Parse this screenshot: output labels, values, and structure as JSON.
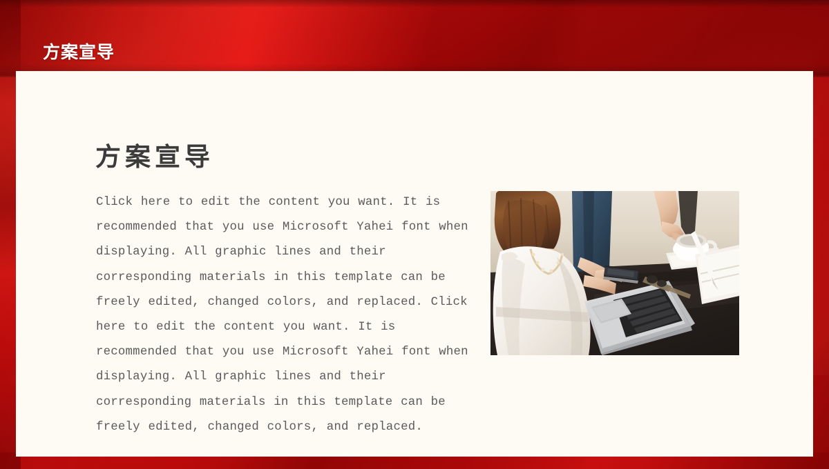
{
  "slide": {
    "header_title": "方案宣导",
    "accent_color": "#c40d0d",
    "panel_color": "#fdfbf4",
    "heading_color": "#3b3b3b",
    "body_color": "#5b5b5b"
  },
  "content": {
    "heading": "方案宣导",
    "body": "Click here to edit the content you want. It is recommended that you use Microsoft Yahei font when displaying. All graphic lines and their corresponding materials in this template can be freely edited, changed colors, and replaced. Click here to edit the content you want. It is recommended that you use Microsoft Yahei font when displaying. All graphic lines and their corresponding materials in this template can be freely edited, changed colors, and replaced."
  },
  "photo": {
    "alt": "Woman in white blouse holding a smartphone beside a laptop on a dark wooden desk, a hand pointing, coffee cup and notebook nearby"
  }
}
